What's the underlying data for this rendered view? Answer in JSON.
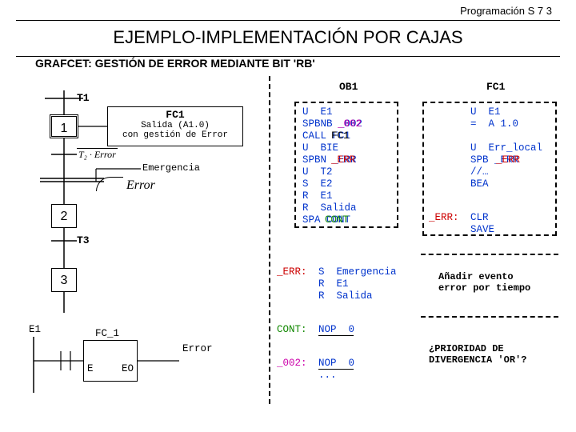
{
  "header": {
    "right": "Programación S 7  3"
  },
  "title": "EJEMPLO-IMPLEMENTACIÓN POR CAJAS",
  "subtitle": "GRAFCET: GESTIÓN DE ERROR MEDIANTE BIT 'RB'",
  "grafcet": {
    "t1": "T1",
    "t3": "T3",
    "step1": "1",
    "step2": "2",
    "step3": "3",
    "box_title": "FC1",
    "box_l1": "Salida (A1.0)",
    "box_l2": "con gestión de Error",
    "emerg": "Emergencia",
    "error": "Error",
    "e1": "E1",
    "fc1": "FC_1",
    "e": "E",
    "eo": "EO",
    "error2": "Error",
    "t2err": "T₂ · Error"
  },
  "ob1": {
    "title": "OB1",
    "code": "U  E1\nSPBNB _002\nCALL FC1\nU  BIE\nSPBN _ERR\nU  T2\nS  E2\nR  E1\nR  Salida\nSPA CONT",
    "err_lbl": "_ERR:",
    "err_code": "S  Emergencia\nR  E1\nR  Salida",
    "cont_lbl": "CONT:",
    "cont_code": "NOP  0",
    "l002_lbl": "_002:",
    "l002_code": "NOP  0\n..."
  },
  "fc1": {
    "title": "FC1",
    "code_u": "U  E1\n=  A 1.0\n\nU  Err_local\nSPB _ERR\n//…\nBEA",
    "err_lbl": "_ERR:",
    "err_code": "CLR\nSAVE"
  },
  "notes": {
    "n1": "Añadir evento\nerror por tiempo",
    "q1": "¿PRIORIDAD DE\nDIVERGENCIA 'OR'?"
  }
}
